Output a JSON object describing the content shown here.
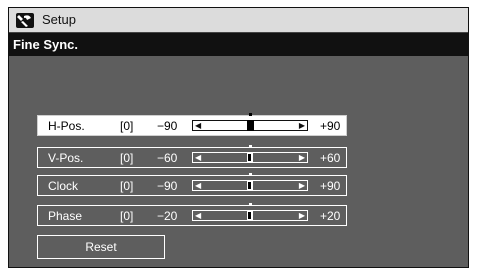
{
  "window": {
    "title": "Setup",
    "icon": "setup-tool-icon"
  },
  "header": {
    "title": "Fine Sync."
  },
  "rows": [
    {
      "label": "H-Pos.",
      "value": "[0]",
      "min": "−90",
      "max": "+90",
      "level": 0.5,
      "selected": true
    },
    {
      "label": "V-Pos.",
      "value": "[0]",
      "min": "−60",
      "max": "+60",
      "level": 0.5,
      "selected": false
    },
    {
      "label": "Clock",
      "value": "[0]",
      "min": "−90",
      "max": "+90",
      "level": 0.5,
      "selected": false
    },
    {
      "label": "Phase",
      "value": "[0]",
      "min": "−20",
      "max": "+20",
      "level": 0.5,
      "selected": false
    }
  ],
  "reset_label": "Reset",
  "colors": {
    "panel": "#5e5e5e",
    "titlebar": "#dcdcdc",
    "subbar": "#111111",
    "highlight": "#ffffff"
  }
}
